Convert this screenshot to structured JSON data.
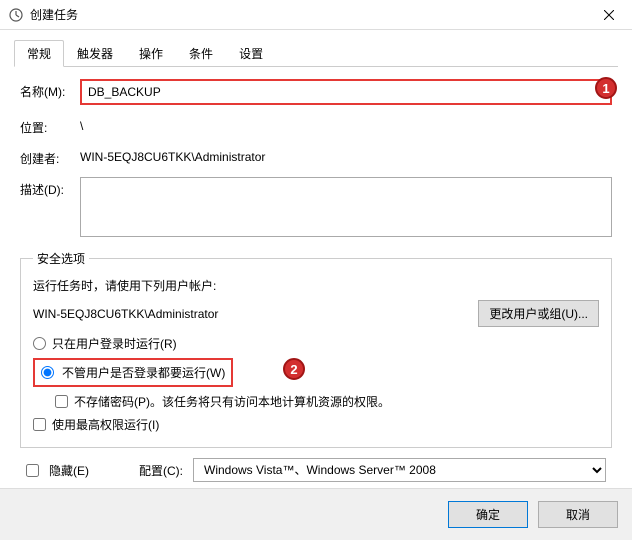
{
  "window": {
    "title": "创建任务"
  },
  "tabs": [
    "常规",
    "触发器",
    "操作",
    "条件",
    "设置"
  ],
  "activeTab": 0,
  "general": {
    "nameLabel": "名称(M):",
    "nameValue": "DB_BACKUP",
    "locationLabel": "位置:",
    "locationValue": "\\",
    "creatorLabel": "创建者:",
    "creatorValue": "WIN-5EQJ8CU6TKK\\Administrator",
    "descLabel": "描述(D):",
    "descValue": ""
  },
  "security": {
    "legend": "安全选项",
    "runAsPrompt": "运行任务时，请使用下列用户帐户:",
    "account": "WIN-5EQJ8CU6TKK\\Administrator",
    "changeUserBtn": "更改用户或组(U)...",
    "radioLoggedOn": "只在用户登录时运行(R)",
    "radioAnyTime": "不管用户是否登录都要运行(W)",
    "noStorePwd": "不存储密码(P)。该任务将只有访问本地计算机资源的权限。",
    "highestPriv": "使用最高权限运行(I)",
    "selected": "anytime",
    "noStorePwdChecked": false,
    "highestPrivChecked": false
  },
  "bottom": {
    "hidden": "隐藏(E)",
    "hiddenChecked": false,
    "configureForLabel": "配置(C):",
    "configureForValue": "Windows Vista™、Windows Server™ 2008"
  },
  "buttons": {
    "ok": "确定",
    "cancel": "取消"
  },
  "markers": {
    "one": "1",
    "two": "2"
  }
}
